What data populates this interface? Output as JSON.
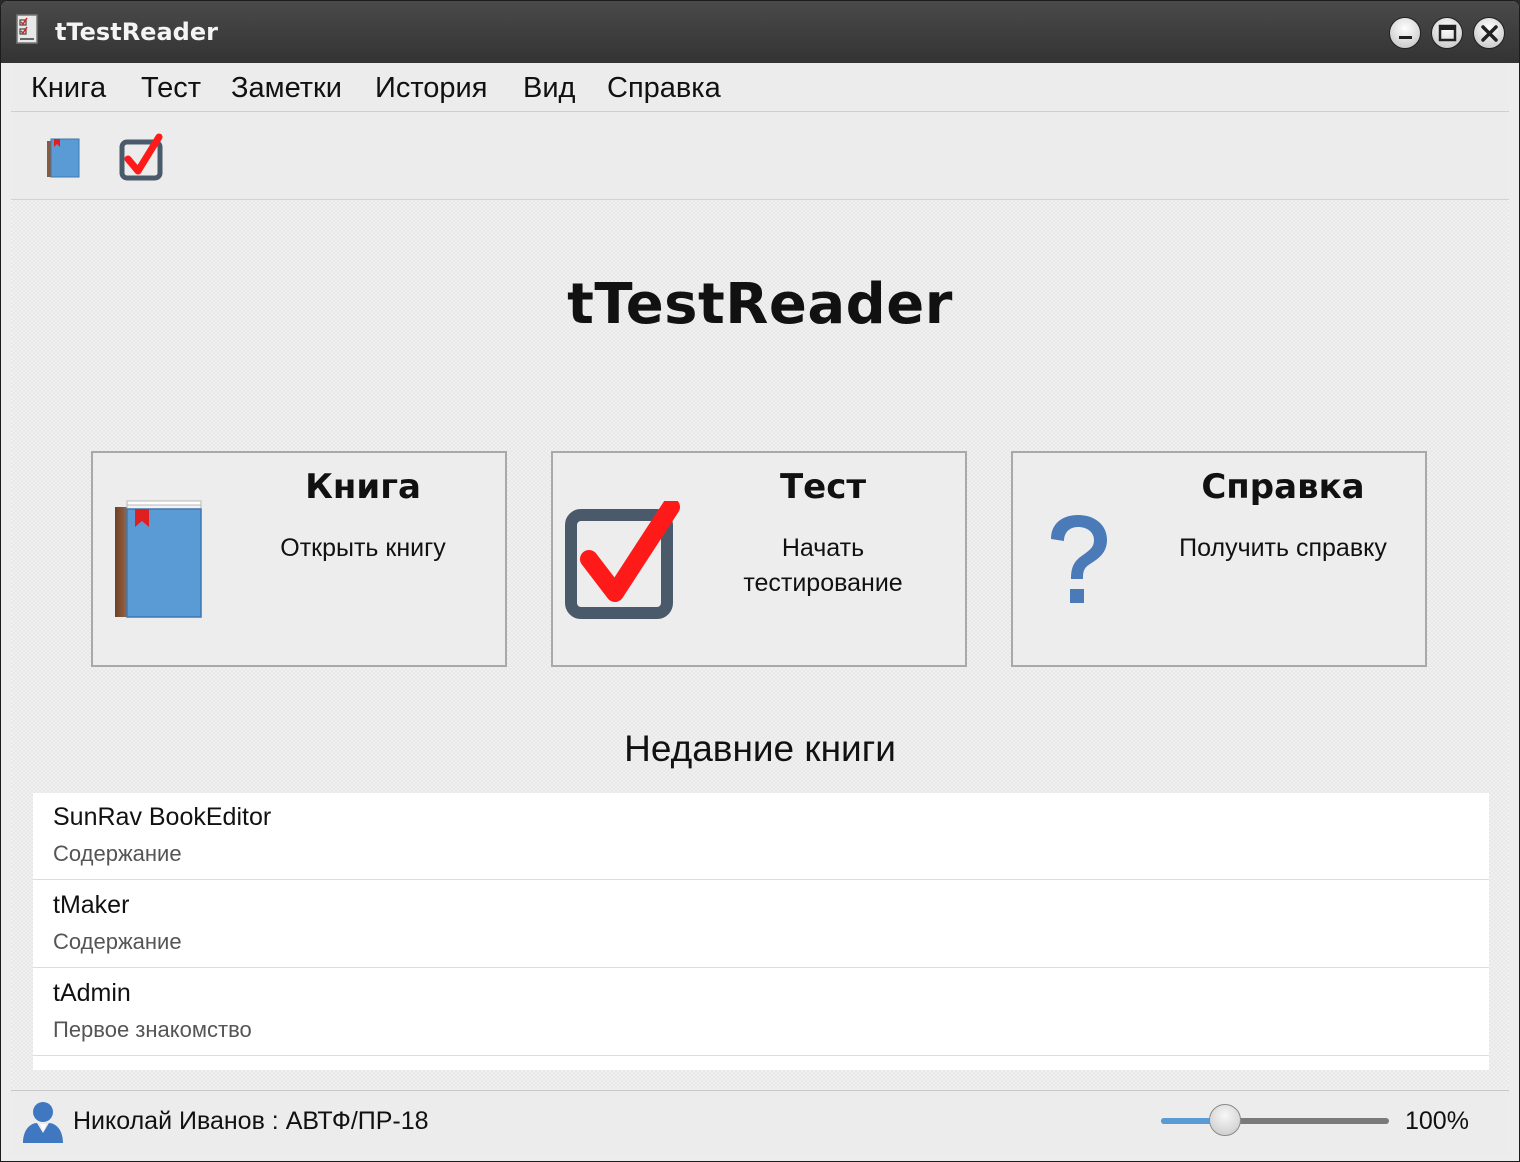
{
  "window": {
    "title": "tTestReader"
  },
  "menu": [
    {
      "label": "Книга"
    },
    {
      "label": "Тест"
    },
    {
      "label": "Заметки"
    },
    {
      "label": "История"
    },
    {
      "label": "Вид"
    },
    {
      "label": "Справка"
    }
  ],
  "toolbar": {
    "icons": [
      "book-icon",
      "checkbox-icon"
    ]
  },
  "main": {
    "title": "tTestReader"
  },
  "cards": [
    {
      "title": "Книга",
      "desc": "Открыть книгу",
      "icon": "book-icon"
    },
    {
      "title": "Тест",
      "desc_line1": "Начать",
      "desc_line2": "тестирование",
      "icon": "checkbox-icon"
    },
    {
      "title": "Справка",
      "desc": "Получить справку",
      "icon": "question-icon"
    }
  ],
  "recent": {
    "title": "Недавние книги",
    "items": [
      {
        "name": "SunRav BookEditor",
        "sub": "Содержание"
      },
      {
        "name": "tMaker",
        "sub": "Содержание"
      },
      {
        "name": "tAdmin",
        "sub": "Первое знакомство"
      }
    ]
  },
  "status": {
    "user": "Николай Иванов : АВТФ/ПР-18",
    "zoom_label": "100%",
    "zoom_fraction": 0.28
  },
  "colors": {
    "accent": "#5b9bd5",
    "book_blue": "#5b9bd5",
    "book_spine": "#8b5a3c",
    "check_red": "#ff1a1a",
    "check_frame": "#4a5a6a",
    "question_blue": "#4a7ab8"
  }
}
